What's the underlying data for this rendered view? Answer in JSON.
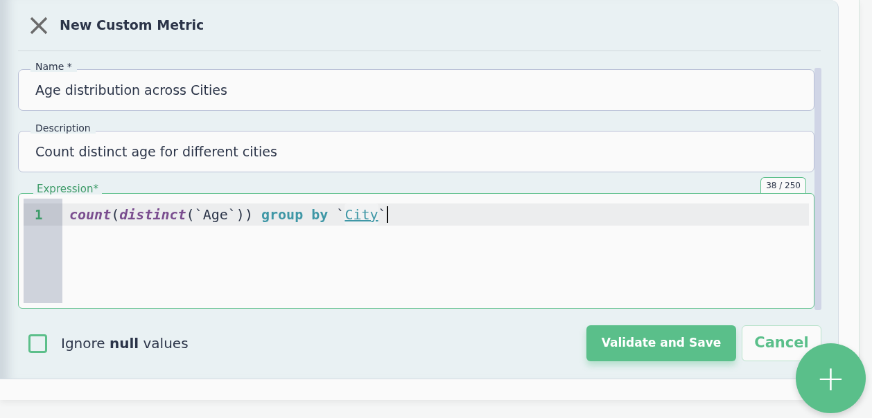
{
  "dialog": {
    "title": "New Custom Metric"
  },
  "fields": [
    {
      "label": "Name",
      "required_mark": "*",
      "value": "Age distribution across Cities"
    },
    {
      "label": "Description",
      "value": "Count distinct age for different cities"
    }
  ],
  "expression": {
    "label": "Expression*",
    "counter": "38 / 250",
    "line_number": "1",
    "tokens": [
      {
        "text": "count",
        "kind": "function"
      },
      {
        "text": "(",
        "kind": "punct"
      },
      {
        "text": "distinct",
        "kind": "function"
      },
      {
        "text": "(`Age`)) ",
        "kind": "punct"
      },
      {
        "text": "group by",
        "kind": "keyword"
      },
      {
        "text": " `",
        "kind": "punct"
      },
      {
        "text": "City",
        "kind": "identifier"
      },
      {
        "text": "`",
        "kind": "punct"
      }
    ]
  },
  "ignore_null": {
    "label": "Ignore **null** values",
    "checked": false
  },
  "buttons": [
    {
      "label": "Validate and Save",
      "kind": "primary"
    },
    {
      "label": "Cancel",
      "kind": "secondary"
    }
  ],
  "fab": {
    "label": "+"
  }
}
